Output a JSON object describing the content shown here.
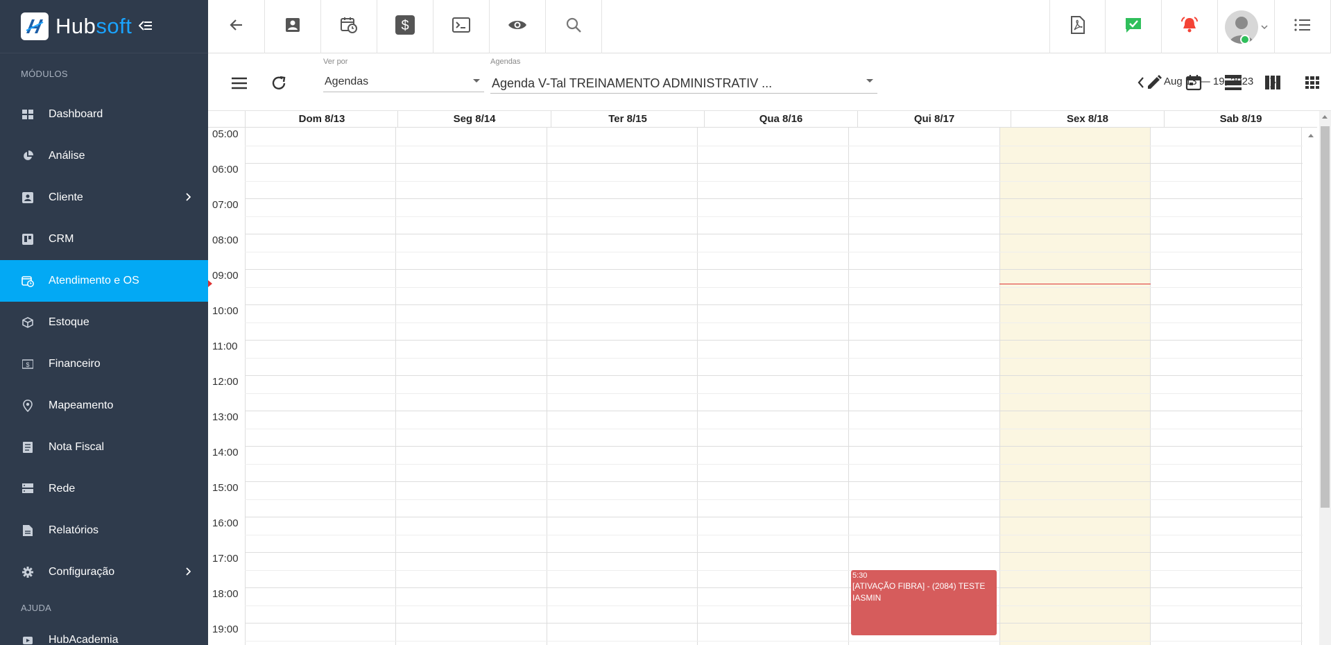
{
  "brand": {
    "hub": "Hub",
    "soft": "soft"
  },
  "sidebar": {
    "section_modules": "MÓDULOS",
    "section_help": "AJUDA",
    "items": [
      {
        "label": "Dashboard",
        "icon": "dashboard-icon"
      },
      {
        "label": "Análise",
        "icon": "pie-chart-icon"
      },
      {
        "label": "Cliente",
        "icon": "contact-card-icon",
        "has_submenu": true
      },
      {
        "label": "CRM",
        "icon": "trello-board-icon"
      },
      {
        "label": "Atendimento e OS",
        "icon": "calendar-clock-icon",
        "active": true
      },
      {
        "label": "Estoque",
        "icon": "package-icon"
      },
      {
        "label": "Financeiro",
        "icon": "money-icon"
      },
      {
        "label": "Mapeamento",
        "icon": "map-pin-icon"
      },
      {
        "label": "Nota Fiscal",
        "icon": "receipt-icon"
      },
      {
        "label": "Rede",
        "icon": "server-icon"
      },
      {
        "label": "Relatórios",
        "icon": "report-icon"
      },
      {
        "label": "Configuração",
        "icon": "gear-icon",
        "has_submenu": true
      }
    ],
    "help_items": [
      {
        "label": "HubAcademia",
        "icon": "video-icon"
      }
    ]
  },
  "toolbar": {
    "view_by_label": "Ver por",
    "view_by_value": "Agendas",
    "agendas_label": "Agendas",
    "agendas_value": "Agenda V-Tal TREINAMENTO ADMINISTRATIV ...",
    "date_range": "Aug 13 — 19, 2023"
  },
  "calendar": {
    "days": [
      "Dom 8/13",
      "Seg 8/14",
      "Ter 8/15",
      "Qua 8/16",
      "Qui 8/17",
      "Sex 8/18",
      "Sab 8/19"
    ],
    "today_index": 5,
    "hours": [
      "05:00",
      "06:00",
      "07:00",
      "08:00",
      "09:00",
      "10:00",
      "11:00",
      "12:00",
      "13:00",
      "14:00",
      "15:00",
      "16:00",
      "17:00",
      "18:00",
      "19:00"
    ],
    "now_time": "09:25",
    "events": [
      {
        "day_index": 4,
        "time": "5:30",
        "title": "[ATIVAÇÃO FIBRA] - (2084) TESTE IASMIN",
        "start": "17:30",
        "end": "19:30",
        "color": "#d65c5c"
      }
    ]
  },
  "colors": {
    "sidebar_bg": "#2f3b4c",
    "active": "#03a9f4",
    "today_bg": "#fbf6e1",
    "event": "#d65c5c",
    "check_badge": "#2fbf5b",
    "alarm": "#f44336"
  }
}
